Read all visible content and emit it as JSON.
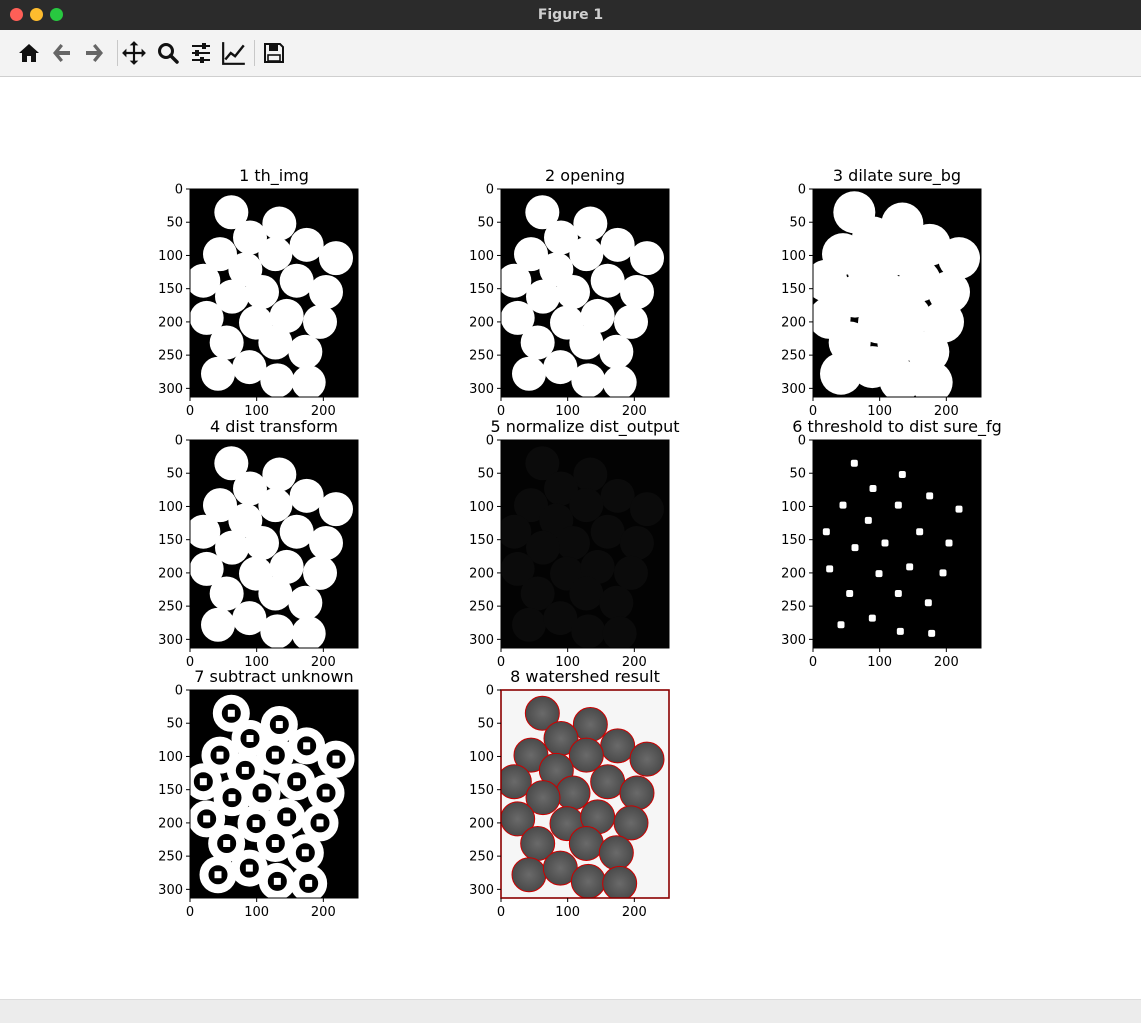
{
  "window": {
    "title": "Figure 1"
  },
  "toolbar": {
    "buttons": [
      {
        "name": "home-button",
        "icon": "home-icon"
      },
      {
        "name": "back-button",
        "icon": "arrow-left-icon"
      },
      {
        "name": "forward-button",
        "icon": "arrow-right-icon"
      },
      {
        "name": "pan-button",
        "icon": "move-icon"
      },
      {
        "name": "zoom-button",
        "icon": "magnifier-icon"
      },
      {
        "name": "configure-subplots-button",
        "icon": "sliders-icon"
      },
      {
        "name": "edit-axis-button",
        "icon": "line-chart-icon"
      },
      {
        "name": "save-button",
        "icon": "floppy-disk-icon"
      }
    ]
  },
  "colors": {
    "titlebar": "#2b2b2b",
    "close": "#ff5f57",
    "minimize": "#febc2e",
    "maximize": "#28c840",
    "contour": "#cc0000"
  },
  "chart_data": [
    {
      "type": "image",
      "title": "1 th_img",
      "kind": "binary",
      "xticks": [
        0,
        100,
        200
      ],
      "yticks": [
        0,
        50,
        100,
        150,
        200,
        250,
        300
      ],
      "xlim": [
        0,
        252
      ],
      "ylim": [
        313,
        0
      ]
    },
    {
      "type": "image",
      "title": "2 opening",
      "kind": "binary",
      "xticks": [
        0,
        100,
        200
      ],
      "yticks": [
        0,
        50,
        100,
        150,
        200,
        250,
        300
      ],
      "xlim": [
        0,
        252
      ],
      "ylim": [
        313,
        0
      ]
    },
    {
      "type": "image",
      "title": "3 dilate sure_bg",
      "kind": "dilated",
      "xticks": [
        0,
        100,
        200
      ],
      "yticks": [
        0,
        50,
        100,
        150,
        200,
        250,
        300
      ],
      "xlim": [
        0,
        252
      ],
      "ylim": [
        313,
        0
      ]
    },
    {
      "type": "image",
      "title": "4 dist transform",
      "kind": "binary",
      "xticks": [
        0,
        100,
        200
      ],
      "yticks": [
        0,
        50,
        100,
        150,
        200,
        250,
        300
      ],
      "xlim": [
        0,
        252
      ],
      "ylim": [
        313,
        0
      ]
    },
    {
      "type": "image",
      "title": "5 normalize dist_output",
      "kind": "dark",
      "xticks": [
        0,
        100,
        200
      ],
      "yticks": [
        0,
        50,
        100,
        150,
        200,
        250,
        300
      ],
      "xlim": [
        0,
        252
      ],
      "ylim": [
        313,
        0
      ]
    },
    {
      "type": "image",
      "title": "6 threshold to dist sure_fg",
      "kind": "peaks",
      "xticks": [
        0,
        100,
        200
      ],
      "yticks": [
        0,
        50,
        100,
        150,
        200,
        250,
        300
      ],
      "xlim": [
        0,
        252
      ],
      "ylim": [
        313,
        0
      ]
    },
    {
      "type": "image",
      "title": "7 subtract unknown",
      "kind": "rings",
      "xticks": [
        0,
        100,
        200
      ],
      "yticks": [
        0,
        50,
        100,
        150,
        200,
        250,
        300
      ],
      "xlim": [
        0,
        252
      ],
      "ylim": [
        313,
        0
      ]
    },
    {
      "type": "image",
      "title": "8 watershed result",
      "kind": "watershed",
      "xticks": [
        0,
        100,
        200
      ],
      "yticks": [
        0,
        50,
        100,
        150,
        200,
        250,
        300
      ],
      "xlim": [
        0,
        252
      ],
      "ylim": [
        313,
        0
      ]
    }
  ]
}
